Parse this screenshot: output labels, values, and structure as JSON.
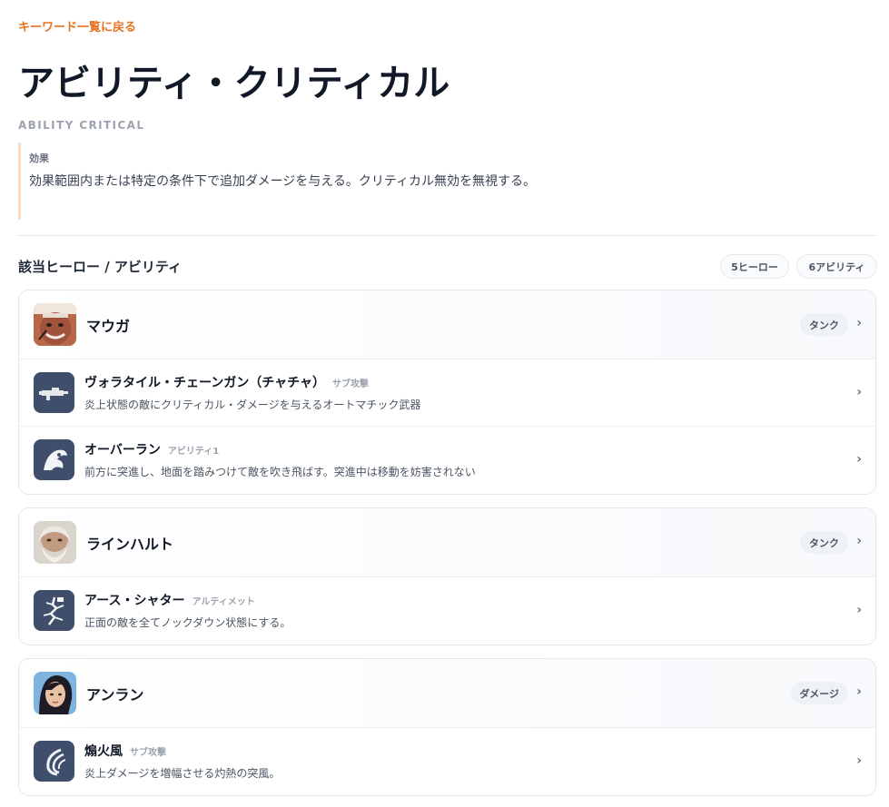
{
  "nav": {
    "back_label": "キーワード一覧に戻る"
  },
  "keyword": {
    "title": "アビリティ・クリティカル",
    "subtitle": "ABILITY CRITICAL",
    "effect_label": "効果",
    "effect_text": "効果範囲内または特定の条件下で追加ダメージを与える。クリティカル無効を無視する。"
  },
  "section": {
    "title": "該当ヒーロー / アビリティ",
    "hero_count": "5ヒーロー",
    "ability_count": "6アビリティ"
  },
  "heroes": [
    {
      "name": "マウガ",
      "role": "タンク",
      "avatar_icon": "mauga-portrait",
      "abilities": [
        {
          "name": "ヴォラタイル・チェーンガン（チャチャ）",
          "type": "サブ攻撃",
          "desc": "炎上状態の敵にクリティカル・ダメージを与えるオートマチック武器",
          "icon": "chaingun-icon"
        },
        {
          "name": "オーバーラン",
          "type": "アビリティ1",
          "desc": "前方に突進し、地面を踏みつけて敵を吹き飛ばす。突進中は移動を妨害されない",
          "icon": "overrun-icon"
        }
      ]
    },
    {
      "name": "ラインハルト",
      "role": "タンク",
      "avatar_icon": "reinhardt-portrait",
      "abilities": [
        {
          "name": "アース・シャター",
          "type": "アルティメット",
          "desc": "正面の敵を全てノックダウン状態にする。",
          "icon": "earthshatter-icon"
        }
      ]
    },
    {
      "name": "アンラン",
      "role": "ダメージ",
      "avatar_icon": "anran-portrait",
      "abilities": [
        {
          "name": "煽火風",
          "type": "サブ攻撃",
          "desc": "炎上ダメージを増幅させる灼熱の突風。",
          "icon": "wind-icon"
        }
      ]
    }
  ],
  "colors": {
    "accent": "#e8711f",
    "ability_icon_bg": "#3f4f6b",
    "badge_bg": "#eef2f7"
  }
}
